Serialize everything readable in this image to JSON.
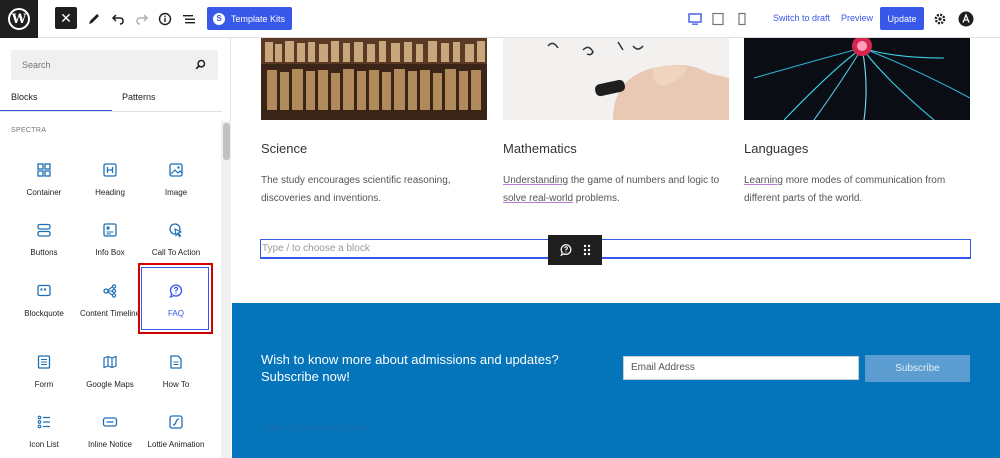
{
  "topbar": {
    "logo_text": "W",
    "close_icon": "✕",
    "template_kits_label": "Template Kits",
    "switch_to_draft_label": "Switch to draft",
    "preview_label": "Preview",
    "update_label": "Update"
  },
  "sidebar": {
    "search_placeholder": "Search",
    "tabs": [
      {
        "label": "Blocks",
        "active": true
      },
      {
        "label": "Patterns",
        "active": false
      }
    ],
    "category": "SPECTRA",
    "blocks": [
      {
        "label": "Container",
        "icon": "container-icon"
      },
      {
        "label": "Heading",
        "icon": "heading-icon"
      },
      {
        "label": "Image",
        "icon": "image-icon"
      },
      {
        "label": "Buttons",
        "icon": "buttons-icon"
      },
      {
        "label": "Info Box",
        "icon": "info-box-icon"
      },
      {
        "label": "Call To Action",
        "icon": "call-to-action-icon"
      },
      {
        "label": "Blockquote",
        "icon": "blockquote-icon"
      },
      {
        "label": "Content Timeline",
        "icon": "timeline-icon"
      },
      {
        "label": "FAQ",
        "icon": "faq-icon"
      },
      {
        "label": "Form",
        "icon": "form-icon"
      },
      {
        "label": "Google Maps",
        "icon": "map-icon"
      },
      {
        "label": "How To",
        "icon": "how-to-icon"
      },
      {
        "label": "Icon List",
        "icon": "icon-list-icon"
      },
      {
        "label": "Inline Notice",
        "icon": "inline-notice-icon"
      },
      {
        "label": "Lottie Animation",
        "icon": "lottie-icon"
      }
    ]
  },
  "content": {
    "columns": [
      {
        "title": "Science",
        "text_lines": [
          "The study encourages scientific reasoning,",
          "discoveries and inventions."
        ]
      },
      {
        "title": "Mathematics",
        "text_lines": [
          "Understanding the game of numbers and logic to",
          "solve real-world problems."
        ]
      },
      {
        "title": "Languages",
        "text_lines": [
          "Learning more modes of communication from",
          "different parts of the world."
        ]
      }
    ],
    "block_placeholder": "Type / to choose a block",
    "cta": {
      "heading_line1": "Wish to know more about admissions and updates?",
      "heading_line2": "Subscribe now!",
      "email_placeholder": "Email Address",
      "subscribe_label": "Subscribe",
      "ghost_placeholder": "Type / to choose a block"
    }
  },
  "colors": {
    "accent": "#3858e9",
    "cta_bg": "#0474bb",
    "highlight": "#d40000"
  }
}
